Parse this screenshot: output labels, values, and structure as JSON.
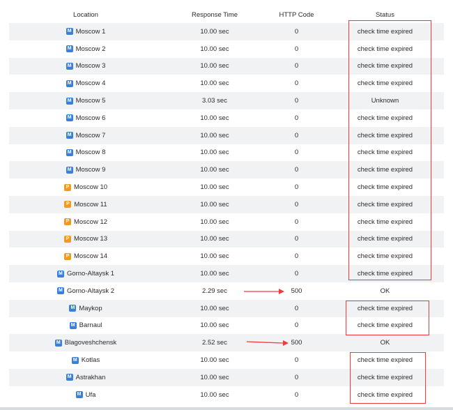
{
  "headers": {
    "location": "Location",
    "response_time": "Response Time",
    "http_code": "HTTP Code",
    "status": "Status"
  },
  "rows": [
    {
      "badge": "M",
      "location": "Moscow 1",
      "time": "10.00 sec",
      "code": "0",
      "status": "check time expired"
    },
    {
      "badge": "M",
      "location": "Moscow 2",
      "time": "10.00 sec",
      "code": "0",
      "status": "check time expired"
    },
    {
      "badge": "M",
      "location": "Moscow 3",
      "time": "10.00 sec",
      "code": "0",
      "status": "check time expired"
    },
    {
      "badge": "M",
      "location": "Moscow 4",
      "time": "10.00 sec",
      "code": "0",
      "status": "check time expired"
    },
    {
      "badge": "M",
      "location": "Moscow 5",
      "time": "3.03 sec",
      "code": "0",
      "status": "Unknown"
    },
    {
      "badge": "M",
      "location": "Moscow 6",
      "time": "10.00 sec",
      "code": "0",
      "status": "check time expired"
    },
    {
      "badge": "M",
      "location": "Moscow 7",
      "time": "10.00 sec",
      "code": "0",
      "status": "check time expired"
    },
    {
      "badge": "M",
      "location": "Moscow 8",
      "time": "10.00 sec",
      "code": "0",
      "status": "check time expired"
    },
    {
      "badge": "M",
      "location": "Moscow 9",
      "time": "10.00 sec",
      "code": "0",
      "status": "check time expired"
    },
    {
      "badge": "P",
      "location": "Moscow 10",
      "time": "10.00 sec",
      "code": "0",
      "status": "check time expired"
    },
    {
      "badge": "P",
      "location": "Moscow 11",
      "time": "10.00 sec",
      "code": "0",
      "status": "check time expired"
    },
    {
      "badge": "P",
      "location": "Moscow 12",
      "time": "10.00 sec",
      "code": "0",
      "status": "check time expired"
    },
    {
      "badge": "P",
      "location": "Moscow 13",
      "time": "10.00 sec",
      "code": "0",
      "status": "check time expired"
    },
    {
      "badge": "P",
      "location": "Moscow 14",
      "time": "10.00 sec",
      "code": "0",
      "status": "check time expired"
    },
    {
      "badge": "M",
      "location": "Gorno-Altaysk 1",
      "time": "10.00 sec",
      "code": "0",
      "status": "check time expired"
    },
    {
      "badge": "M",
      "location": "Gorno-Altaysk 2",
      "time": "2.29 sec",
      "code": "500",
      "status": "OK"
    },
    {
      "badge": "M",
      "location": "Maykop",
      "time": "10.00 sec",
      "code": "0",
      "status": "check time expired"
    },
    {
      "badge": "M",
      "location": "Barnaul",
      "time": "10.00 sec",
      "code": "0",
      "status": "check time expired"
    },
    {
      "badge": "M",
      "location": "Blagoveshchensk",
      "time": "2.52 sec",
      "code": "500",
      "status": "OK"
    },
    {
      "badge": "M",
      "location": "Kotlas",
      "time": "10.00 sec",
      "code": "0",
      "status": "check time expired"
    },
    {
      "badge": "M",
      "location": "Astrakhan",
      "time": "10.00 sec",
      "code": "0",
      "status": "check time expired"
    },
    {
      "badge": "M",
      "location": "Ufa",
      "time": "10.00 sec",
      "code": "0",
      "status": "check time expired"
    }
  ],
  "colors": {
    "annotation": "#ef3b3b",
    "badge_m": "#3b7fd8",
    "badge_p": "#f29a1b",
    "stripe": "#f1f2f4"
  }
}
